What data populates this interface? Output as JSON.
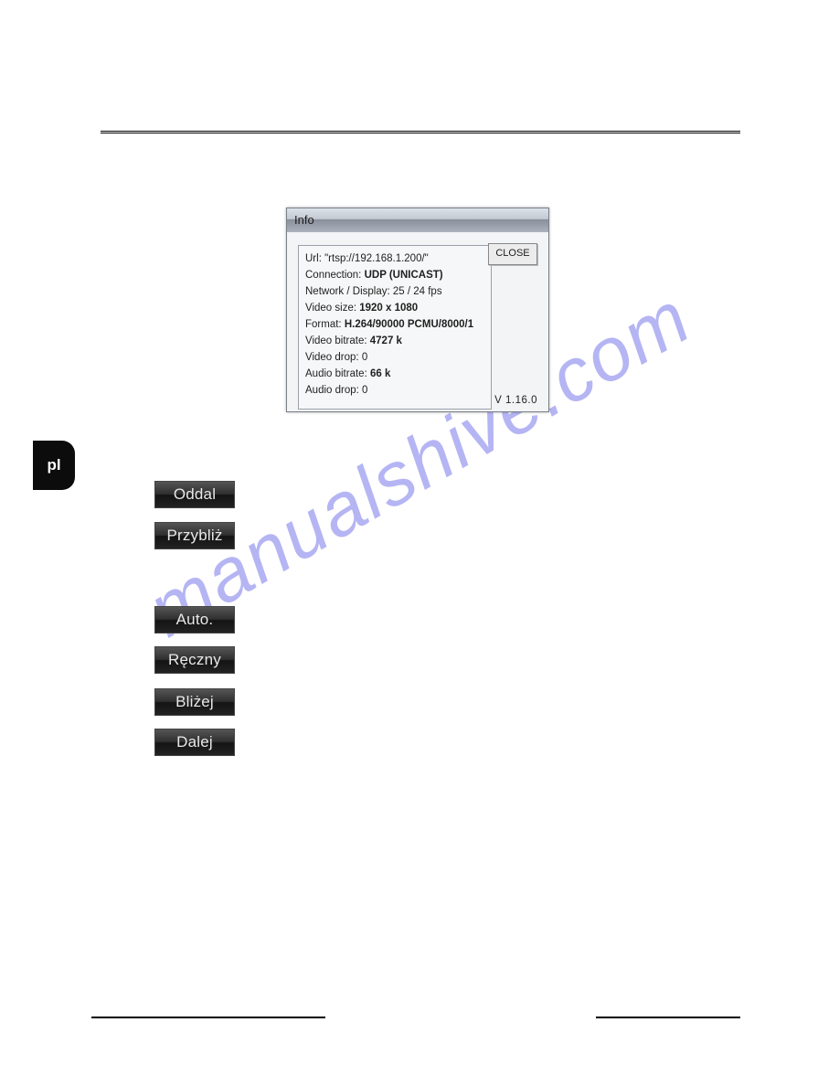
{
  "hrVisible": true,
  "watermark_text": "manualshive.com",
  "pl_tab": "pl",
  "dialog": {
    "title": "Info",
    "close_label": "CLOSE",
    "version": "V 1.16.0",
    "lines": {
      "url_label": "Url:",
      "url_value": "\"rtsp://192.168.1.200/\"",
      "connection_label": "Connection:",
      "connection_value": "UDP (UNICAST)",
      "network_label": "Network / Display:",
      "network_value": "25 / 24 fps",
      "videosize_label": "Video size:",
      "videosize_value": "1920 x 1080",
      "format_label": "Format:",
      "format_value": "H.264/90000 PCMU/8000/1",
      "vbitrate_label": "Video bitrate:",
      "vbitrate_value": "4727 k",
      "vdrop_label": "Video drop:",
      "vdrop_value": "0",
      "abitrate_label": "Audio bitrate:",
      "abitrate_value": "66 k",
      "adrop_label": "Audio drop:",
      "adrop_value": "0"
    }
  },
  "buttons": {
    "oddal": "Oddal",
    "przybliz": "Przybliż",
    "auto": "Auto.",
    "reczny": "Ręczny",
    "blizej": "Bliżej",
    "dalej": "Dalej"
  }
}
